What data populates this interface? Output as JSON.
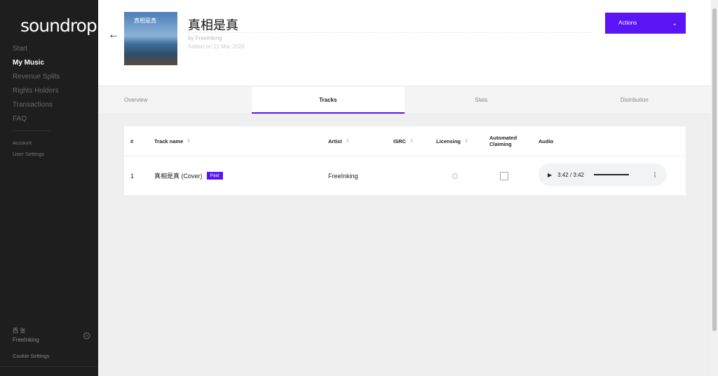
{
  "sidebar": {
    "logo": "soundrop",
    "nav": [
      "Start",
      "My Music",
      "Revenue Splits",
      "Rights Holders",
      "Transactions",
      "FAQ"
    ],
    "sub": [
      "Account",
      "User Settings"
    ],
    "user_name": "西 张",
    "user_handle": "FreeInking",
    "cookie": "Cookie Settings"
  },
  "header": {
    "cover_text": "真相是真",
    "title": "真相是真",
    "by": "by FreeInking",
    "added": "Added on 11 Mar 2026",
    "actions": "Actions"
  },
  "tabs": [
    "Overview",
    "Tracks",
    "Stats",
    "Distribution"
  ],
  "table": {
    "headers": {
      "num": "#",
      "track": "Track name",
      "artist": "Artist",
      "isrc": "ISRC",
      "licensing": "Licensing",
      "claiming": "Automated Claiming",
      "audio": "Audio"
    },
    "rows": [
      {
        "num": "1",
        "track": "真相是真 (Cover)",
        "badge": "Paid",
        "artist": "FreeInking",
        "time": "3:42 / 3:42"
      }
    ]
  },
  "colors": {
    "accent": "#5b14f5",
    "sidebar": "#1e1e1e"
  }
}
